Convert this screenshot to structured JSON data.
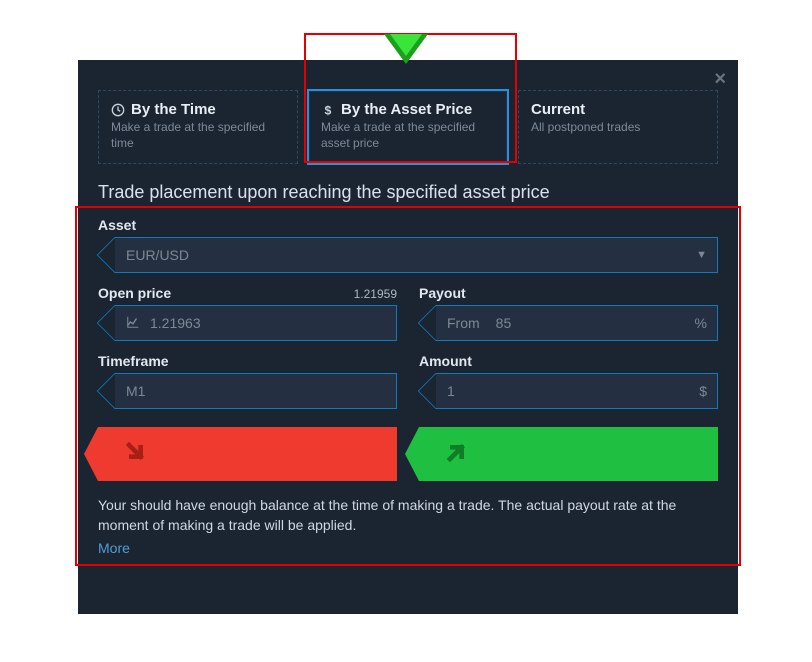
{
  "tabs": {
    "time": {
      "title": "By the Time",
      "sub": "Make a trade at the specified time"
    },
    "price": {
      "title": "By the Asset Price",
      "sub": "Make a trade at the specified asset price"
    },
    "current": {
      "title": "Current",
      "sub": "All postponed trades"
    }
  },
  "section_title": "Trade placement upon reaching the specified asset price",
  "asset": {
    "label": "Asset",
    "value": "EUR/USD"
  },
  "open_price": {
    "label": "Open price",
    "hint": "1.21959",
    "value": "1.21963"
  },
  "payout": {
    "label": "Payout",
    "prefix": "From",
    "value": "85",
    "suffix": "%"
  },
  "timeframe": {
    "label": "Timeframe",
    "value": "M1"
  },
  "amount": {
    "label": "Amount",
    "value": "1",
    "suffix": "$"
  },
  "note": "Your should have enough balance at the time of making a trade. The actual payout rate at the moment of making a trade will be applied.",
  "more": "More"
}
